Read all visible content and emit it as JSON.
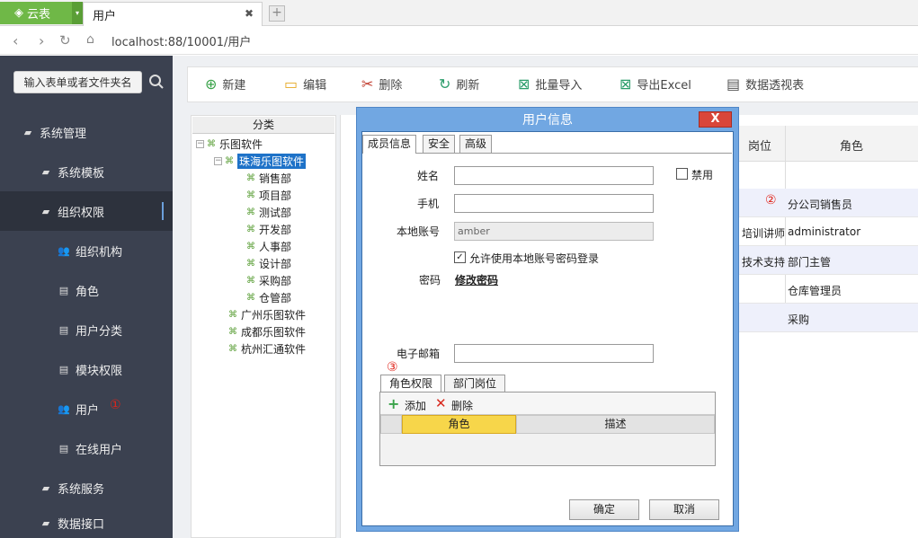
{
  "browser": {
    "brand": "云表",
    "active_tab": "用户",
    "address": "localhost:88/10001/用户"
  },
  "sidebar": {
    "search_placeholder": "输入表单或者文件夹名",
    "items": [
      {
        "label": "系统管理"
      },
      {
        "label": "系统模板"
      },
      {
        "label": "组织权限"
      },
      {
        "label": "组织机构"
      },
      {
        "label": "角色"
      },
      {
        "label": "用户分类"
      },
      {
        "label": "模块权限"
      },
      {
        "label": "用户"
      },
      {
        "label": "在线用户"
      },
      {
        "label": "系统服务"
      },
      {
        "label": "数据接口"
      }
    ]
  },
  "toolbar": {
    "new": "新建",
    "edit": "编辑",
    "delete": "删除",
    "refresh": "刷新",
    "import": "批量导入",
    "export": "导出Excel",
    "pivot": "数据透视表"
  },
  "tree": {
    "header": "分类",
    "root": "乐图软件",
    "branch_selected": "珠海乐图软件",
    "children": [
      "销售部",
      "项目部",
      "测试部",
      "开发部",
      "人事部",
      "设计部",
      "采购部",
      "仓管部"
    ],
    "siblings": [
      "广州乐图软件",
      "成都乐图软件",
      "杭州汇通软件"
    ]
  },
  "grid": {
    "col_position": "岗位",
    "col_role": "角色",
    "rows": [
      {
        "position": "",
        "role": ""
      },
      {
        "position": "",
        "role": "分公司销售员"
      },
      {
        "position": "培训讲师",
        "role": "administrator"
      },
      {
        "position": "技术支持",
        "role": "部门主管"
      },
      {
        "position": "",
        "role": "仓库管理员"
      },
      {
        "position": "",
        "role": "采购"
      }
    ]
  },
  "dialog": {
    "title": "用户信息",
    "close": "X",
    "tabs": [
      "成员信息",
      "安全",
      "高级"
    ],
    "name_label": "姓名",
    "name_value": "",
    "disabled_label": "禁用",
    "phone_label": "手机",
    "local_account_label": "本地账号",
    "local_account_value": "amber",
    "allow_local_login": "允许使用本地账号密码登录",
    "password_label": "密码",
    "change_password": "修改密码",
    "email_label": "电子邮箱",
    "subtabs": [
      "角色权限",
      "部门岗位"
    ],
    "add": "添加",
    "remove": "删除",
    "role_col": "角色",
    "desc_col": "描述",
    "ok": "确定",
    "cancel": "取消"
  },
  "annotations": {
    "one": "①",
    "two": "②",
    "three": "③"
  },
  "colors": {
    "sidebar_bg": "#3b4150",
    "dialog_frame": "#71a7e2",
    "brand_green": "#6fb847",
    "selected_header": "#f7d64a"
  }
}
